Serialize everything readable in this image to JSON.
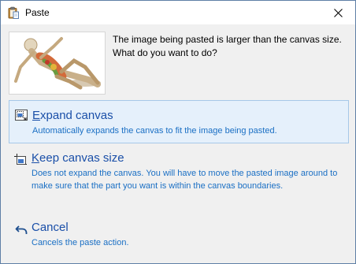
{
  "window": {
    "title": "Paste",
    "close_label": "Close"
  },
  "message": "The image being pasted is larger than the canvas size. What do you want to do?",
  "options": [
    {
      "mnemonic": "E",
      "title_rest": "xpand canvas",
      "description": "Automatically expands the canvas to fit the image being pasted.",
      "icon": "expand-canvas-icon",
      "selected": true
    },
    {
      "mnemonic": "K",
      "title_rest": "eep canvas size",
      "description": "Does not expand the canvas. You will have to move the pasted image around to make sure that the part you want is within the canvas boundaries.",
      "icon": "keep-canvas-icon",
      "selected": false
    },
    {
      "mnemonic": "",
      "title_rest": "Cancel",
      "description": "Cancels the paste action.",
      "icon": "undo-arrow-icon",
      "selected": false
    }
  ],
  "colors": {
    "option_title": "#1a4fa8",
    "option_description": "#1a6fc4",
    "selected_bg": "#e5f0fb",
    "selected_border": "#a6c8e8"
  }
}
